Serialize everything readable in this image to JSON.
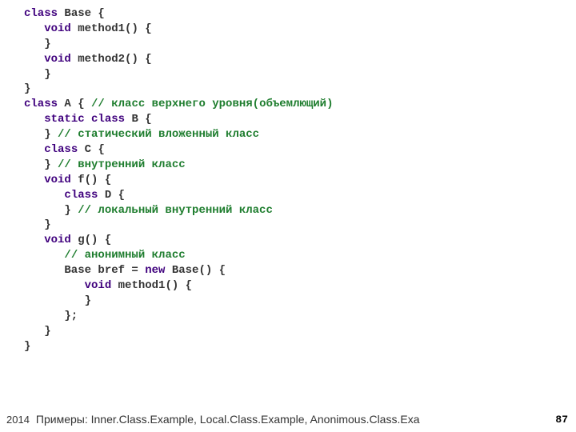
{
  "code_lines": [
    [
      {
        "cls": "kw",
        "t": "class"
      },
      {
        "cls": "id",
        "t": " Base {"
      }
    ],
    [
      {
        "cls": "pl",
        "t": "   "
      },
      {
        "cls": "kw",
        "t": "void"
      },
      {
        "cls": "id",
        "t": " method1() {"
      }
    ],
    [
      {
        "cls": "pl",
        "t": "   }"
      }
    ],
    [
      {
        "cls": "pl",
        "t": "   "
      },
      {
        "cls": "kw",
        "t": "void"
      },
      {
        "cls": "id",
        "t": " method2() {"
      }
    ],
    [
      {
        "cls": "pl",
        "t": "   }"
      }
    ],
    [
      {
        "cls": "pl",
        "t": "}"
      }
    ],
    [
      {
        "cls": "kw",
        "t": "class"
      },
      {
        "cls": "id",
        "t": " A { "
      },
      {
        "cls": "cm",
        "t": "// класс верхнего уровня(объемлющий)"
      }
    ],
    [
      {
        "cls": "pl",
        "t": "   "
      },
      {
        "cls": "kw",
        "t": "static class"
      },
      {
        "cls": "id",
        "t": " B {"
      }
    ],
    [
      {
        "cls": "pl",
        "t": "   } "
      },
      {
        "cls": "cm",
        "t": "// статический вложенный класс"
      }
    ],
    [
      {
        "cls": "pl",
        "t": "   "
      },
      {
        "cls": "kw",
        "t": "class"
      },
      {
        "cls": "id",
        "t": " C {"
      }
    ],
    [
      {
        "cls": "pl",
        "t": "   } "
      },
      {
        "cls": "cm",
        "t": "// внутренний класс"
      }
    ],
    [
      {
        "cls": "pl",
        "t": "   "
      },
      {
        "cls": "kw",
        "t": "void"
      },
      {
        "cls": "id",
        "t": " f() {"
      }
    ],
    [
      {
        "cls": "pl",
        "t": "      "
      },
      {
        "cls": "kw",
        "t": "class"
      },
      {
        "cls": "id",
        "t": " D {"
      }
    ],
    [
      {
        "cls": "pl",
        "t": "      } "
      },
      {
        "cls": "cm",
        "t": "// локальный внутренний класс"
      }
    ],
    [
      {
        "cls": "pl",
        "t": "   }"
      }
    ],
    [
      {
        "cls": "pl",
        "t": "   "
      },
      {
        "cls": "kw",
        "t": "void"
      },
      {
        "cls": "id",
        "t": " g() {"
      }
    ],
    [
      {
        "cls": "pl",
        "t": "      "
      },
      {
        "cls": "cm",
        "t": "// анонимный класс"
      }
    ],
    [
      {
        "cls": "pl",
        "t": "      Base bref = "
      },
      {
        "cls": "kw",
        "t": "new"
      },
      {
        "cls": "id",
        "t": " Base() {"
      }
    ],
    [
      {
        "cls": "pl",
        "t": "         "
      },
      {
        "cls": "kw",
        "t": "void"
      },
      {
        "cls": "id",
        "t": " method1() {"
      }
    ],
    [
      {
        "cls": "pl",
        "t": "         }"
      }
    ],
    [
      {
        "cls": "pl",
        "t": "      };"
      }
    ],
    [
      {
        "cls": "pl",
        "t": "   }"
      }
    ],
    [
      {
        "cls": "pl",
        "t": "}"
      }
    ]
  ],
  "footer": {
    "year": "2014",
    "note": "Примеры: Inner.Class.Example, Local.Class.Example, Anonimous.Class.Exa",
    "page": "87"
  }
}
